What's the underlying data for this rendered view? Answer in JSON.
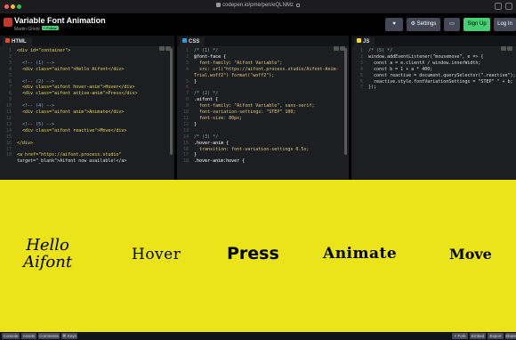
{
  "browser": {
    "url": "codepen.io/pme/pen/eQLNMz"
  },
  "header": {
    "title": "Variable Font Animation",
    "author": "Martin Griebl",
    "follow_label": "+ Follow",
    "settings_label": "Settings",
    "signup_label": "Sign Up",
    "login_label": "Log In"
  },
  "panels": {
    "html": {
      "name": "HTML",
      "lines": [
        {
          "n": "1",
          "t": "<div id=\"container\">"
        },
        {
          "n": "2",
          "t": ""
        },
        {
          "n": "3",
          "t": "  <!-- (1) -->"
        },
        {
          "n": "4",
          "t": "  <div class=\"aifont\">Hello Aifont</div>"
        },
        {
          "n": "5",
          "t": ""
        },
        {
          "n": "6",
          "t": "  <!-- (2) -->"
        },
        {
          "n": "7",
          "t": "  <div class=\"aifont hover-anim\">Hover</div>"
        },
        {
          "n": "8",
          "t": "  <div class=\"aifont active-anim\">Press</div>"
        },
        {
          "n": "9",
          "t": ""
        },
        {
          "n": "10",
          "t": "  <!-- (4) -->"
        },
        {
          "n": "11",
          "t": "  <div class=\"aifont anim\">Animate</div>"
        },
        {
          "n": "12",
          "t": ""
        },
        {
          "n": "13",
          "t": "  <!-- (5) -->"
        },
        {
          "n": "14",
          "t": "  <div class=\"aifont reactive\">Move</div>"
        },
        {
          "n": "15",
          "t": ""
        },
        {
          "n": "16",
          "t": "</div>"
        },
        {
          "n": "17",
          "t": ""
        },
        {
          "n": "18",
          "t": "<a href=\"https://aifont.process.studio\""
        },
        {
          "n": "",
          "t": "target=\"_blank\">Aifont now available!</a>"
        }
      ]
    },
    "css": {
      "name": "CSS",
      "lines": [
        {
          "n": "1",
          "t": "/* (1) */"
        },
        {
          "n": "2",
          "t": "@font-face {"
        },
        {
          "n": "3",
          "t": "  font-family: \"Aifont Variable\";"
        },
        {
          "n": "4",
          "t": "  src: url(\"https://aifont.process.studio/Aifont-Anim-"
        },
        {
          "n": "",
          "t": "Trial.woff2\") format(\"woff2\");"
        },
        {
          "n": "5",
          "t": "}"
        },
        {
          "n": "6",
          "t": ""
        },
        {
          "n": "7",
          "t": "/* (2) */"
        },
        {
          "n": "8",
          "t": ".aifont {"
        },
        {
          "n": "9",
          "t": "  font-family: \"Aifont Variable\", sans-serif;"
        },
        {
          "n": "10",
          "t": "  font-variation-settings: \"STEP\" 100;"
        },
        {
          "n": "11",
          "t": "  font-size: 80px;"
        },
        {
          "n": "12",
          "t": "}"
        },
        {
          "n": "13",
          "t": ""
        },
        {
          "n": "14",
          "t": "/* (3) */"
        },
        {
          "n": "15",
          "t": ".hover-anim {"
        },
        {
          "n": "16",
          "t": "  transition: font-variation-settings 0.5s;"
        },
        {
          "n": "17",
          "t": "}"
        },
        {
          "n": "18",
          "t": ".hover-anim:hover {"
        }
      ]
    },
    "js": {
      "name": "JS",
      "lines": [
        {
          "n": "1",
          "t": "/* (5) */"
        },
        {
          "n": "2",
          "t": "window.addEventListener(\"mousemove\", e => {"
        },
        {
          "n": "3",
          "t": "  const a = e.clientX / window.innerWidth;"
        },
        {
          "n": "4",
          "t": "  const b = 1 + a * 400;"
        },
        {
          "n": "5",
          "t": "  const reactive = document.querySelector(\".reactive\");"
        },
        {
          "n": "6",
          "t": "  reactive.style.fontVariationSettings = \"STEP\" \" + b;"
        },
        {
          "n": "7",
          "t": "});"
        }
      ]
    }
  },
  "preview": {
    "hello_line1": "Hello",
    "hello_line2": "Aifont",
    "hover": "Hover",
    "press": "Press",
    "animate": "Animate",
    "move": "Move"
  },
  "footer": {
    "console": "Console",
    "assets": "Assets",
    "comments": "Comments",
    "keys": "⌘ Keys",
    "fork": "⑂ Fork",
    "embed": "Embed",
    "export": "Export",
    "share": "Share"
  },
  "colors": {
    "preview_bg": "#ebe418",
    "editor_bg": "#1d1e22",
    "header_bg": "#000000",
    "signup": "#47cf73",
    "html_icon": "#e34c26",
    "css_icon": "#2c9bd6",
    "js_icon": "#f7df1e"
  }
}
